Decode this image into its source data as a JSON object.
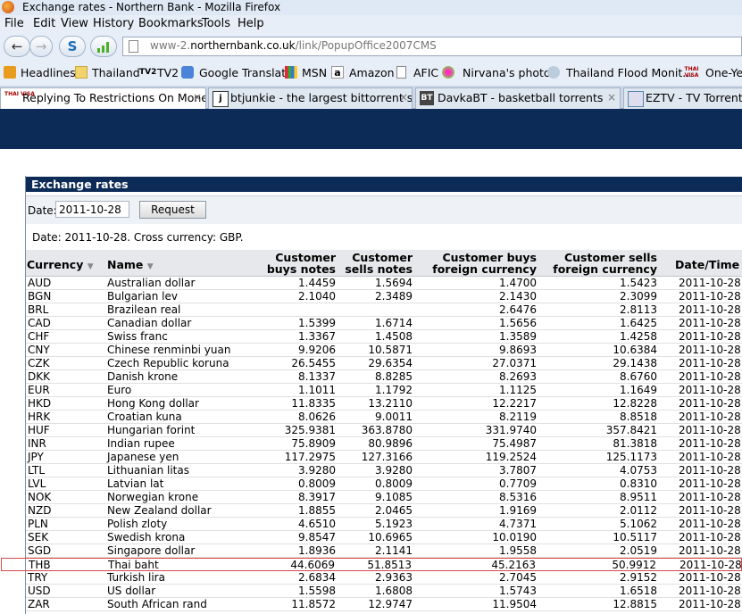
{
  "window": {
    "title": "Exchange rates - Northern Bank - Mozilla Firefox"
  },
  "menu": [
    "File",
    "Edit",
    "View",
    "History",
    "Bookmarks",
    "Tools",
    "Help"
  ],
  "address": {
    "url_prefix": "www-2.",
    "url_domain": "northernbank.co.uk",
    "url_path": "/link/PopupOffice2007CMS"
  },
  "bookmarks": [
    "Headlines",
    "Thailand",
    "TV2",
    "Google Translate",
    "MSN",
    "Amazon",
    "AFIC",
    "Nirvana's photos",
    "Thailand Flood Monit...",
    "One-Ye"
  ],
  "bookmark_icon_text": {
    "tv2": "TV2",
    "amazon": "a",
    "thai_visa": "THAI VISA"
  },
  "tabs": [
    {
      "icon": "THAI VISA",
      "label": "Replying To Restrictions On Mone..."
    },
    {
      "icon": "j",
      "label": "btjunkie - the largest bittorrent se..."
    },
    {
      "icon": "BT",
      "label": "DavkaBT - basketball torrents"
    },
    {
      "icon": "",
      "label": "EZTV - TV Torrents O"
    }
  ],
  "tab_close_glyph": "×",
  "panel": {
    "title": "Exchange rates",
    "date_label": "Date:",
    "date_value": "2011-10-28",
    "request_label": "Request",
    "info": "Date: 2011-10-28. Cross currency: GBP."
  },
  "table": {
    "headers": {
      "currency": "Currency",
      "name": "Name",
      "buys_notes_1": "Customer",
      "buys_notes_2": "buys notes",
      "sells_notes_1": "Customer",
      "sells_notes_2": "sells notes",
      "buys_foreign_1": "Customer buys",
      "buys_foreign_2": "foreign currency",
      "sells_foreign_1": "Customer sells",
      "sells_foreign_2": "foreign currency",
      "datetime": "Date/Time"
    },
    "rows": [
      [
        "AUD",
        "Australian dollar",
        "1.4459",
        "1.5694",
        "1.4700",
        "1.5423",
        "2011-10-28"
      ],
      [
        "BGN",
        "Bulgarian lev",
        "2.1040",
        "2.3489",
        "2.1430",
        "2.3099",
        "2011-10-28"
      ],
      [
        "BRL",
        "Brazilean real",
        "",
        "",
        "2.6476",
        "2.8113",
        "2011-10-28"
      ],
      [
        "CAD",
        "Canadian dollar",
        "1.5399",
        "1.6714",
        "1.5656",
        "1.6425",
        "2011-10-28"
      ],
      [
        "CHF",
        "Swiss franc",
        "1.3367",
        "1.4508",
        "1.3589",
        "1.4258",
        "2011-10-28"
      ],
      [
        "CNY",
        "Chinese renminbi yuan",
        "9.9206",
        "10.5871",
        "9.8693",
        "10.6384",
        "2011-10-28"
      ],
      [
        "CZK",
        "Czech Republic koruna",
        "26.5455",
        "29.6354",
        "27.0371",
        "29.1438",
        "2011-10-28"
      ],
      [
        "DKK",
        "Danish krone",
        "8.1337",
        "8.8285",
        "8.2693",
        "8.6760",
        "2011-10-28"
      ],
      [
        "EUR",
        "Euro",
        "1.1011",
        "1.1792",
        "1.1125",
        "1.1649",
        "2011-10-28"
      ],
      [
        "HKD",
        "Hong Kong dollar",
        "11.8335",
        "13.2110",
        "12.2217",
        "12.8228",
        "2011-10-28"
      ],
      [
        "HRK",
        "Croatian kuna",
        "8.0626",
        "9.0011",
        "8.2119",
        "8.8518",
        "2011-10-28"
      ],
      [
        "HUF",
        "Hungarian forint",
        "325.9381",
        "363.8780",
        "331.9740",
        "357.8421",
        "2011-10-28"
      ],
      [
        "INR",
        "Indian rupee",
        "75.8909",
        "80.9896",
        "75.4987",
        "81.3818",
        "2011-10-28"
      ],
      [
        "JPY",
        "Japanese yen",
        "117.2975",
        "127.3166",
        "119.2524",
        "125.1173",
        "2011-10-28"
      ],
      [
        "LTL",
        "Lithuanian litas",
        "3.9280",
        "3.9280",
        "3.7807",
        "4.0753",
        "2011-10-28"
      ],
      [
        "LVL",
        "Latvian lat",
        "0.8009",
        "0.8009",
        "0.7709",
        "0.8310",
        "2011-10-28"
      ],
      [
        "NOK",
        "Norwegian krone",
        "8.3917",
        "9.1085",
        "8.5316",
        "8.9511",
        "2011-10-28"
      ],
      [
        "NZD",
        "New Zealand dollar",
        "1.8855",
        "2.0465",
        "1.9169",
        "2.0112",
        "2011-10-28"
      ],
      [
        "PLN",
        "Polish zloty",
        "4.6510",
        "5.1923",
        "4.7371",
        "5.1062",
        "2011-10-28"
      ],
      [
        "SEK",
        "Swedish krona",
        "9.8547",
        "10.6965",
        "10.0190",
        "10.5117",
        "2011-10-28"
      ],
      [
        "SGD",
        "Singapore dollar",
        "1.8936",
        "2.1141",
        "1.9558",
        "2.0519",
        "2011-10-28"
      ],
      [
        "THB",
        "Thai baht",
        "44.6069",
        "51.8513",
        "45.2163",
        "50.9912",
        "2011-10-28"
      ],
      [
        "TRY",
        "Turkish lira",
        "2.6834",
        "2.9363",
        "2.7045",
        "2.9152",
        "2011-10-28"
      ],
      [
        "USD",
        "US dollar",
        "1.5598",
        "1.6808",
        "1.5743",
        "1.6518",
        "2011-10-28"
      ],
      [
        "ZAR",
        "South African rand",
        "11.8572",
        "12.9747",
        "11.9504",
        "12.8815",
        "2011-10-28"
      ]
    ],
    "highlight_code": "THB"
  },
  "colors": {
    "banner": "#0d2b57",
    "highlight_border": "#d64a4a"
  },
  "icons": {
    "back": "back-arrow-icon",
    "forward": "forward-arrow-icon",
    "skype": "skype-icon",
    "signal": "signal-bars-icon",
    "sort": "sort-down-arrow-icon"
  }
}
